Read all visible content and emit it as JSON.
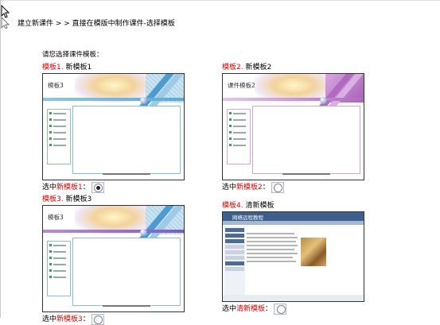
{
  "breadcrumb": "建立新课件 > > 直接在模版中制作课件-选择模板",
  "prompt": "请您选择课件模板：",
  "templates": [
    {
      "title_prefix": "模板1.",
      "title_name": "新模板1",
      "thumb_label": "模板3",
      "select_prefix": "选中",
      "select_name": "新模板1",
      "select_suffix": "：",
      "selected": true,
      "accent": "#5fa8d8"
    },
    {
      "title_prefix": "模板2.",
      "title_name": "新模板2",
      "thumb_label": "课件模板2",
      "select_prefix": "选中",
      "select_name": "新模板2",
      "select_suffix": "：",
      "selected": false,
      "accent": "#b06bbf"
    },
    {
      "title_prefix": "模板3.",
      "title_name": "新模板3",
      "thumb_label": "模板3",
      "select_prefix": "选中",
      "select_name": "新模板3",
      "select_suffix": "：",
      "selected": false,
      "accent": "#5fa8d8"
    },
    {
      "title_prefix": "模板4.",
      "title_name": "清新模板",
      "thumb_label": "网络远程教程",
      "select_prefix": "选中",
      "select_name": "清新模板",
      "select_suffix": "：",
      "selected": false,
      "accent": "#3d5f8c"
    }
  ]
}
